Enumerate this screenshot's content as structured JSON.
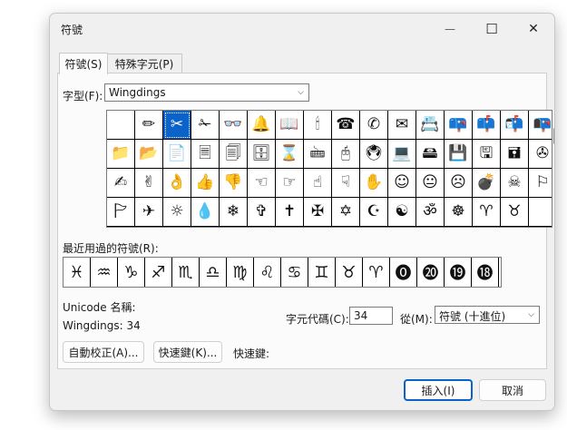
{
  "window": {
    "title": "符號",
    "controls": [
      "—",
      "☐",
      "✕"
    ]
  },
  "tabs": [
    {
      "label": "符號(S)",
      "active": true
    },
    {
      "label": "特殊字元(P)",
      "active": false
    }
  ],
  "font": {
    "label": "字型(F):",
    "value": "Wingdings"
  },
  "symbol_grid": {
    "rows": [
      [
        "",
        "✏",
        "✂",
        "✁",
        "👓",
        "🔔",
        "📖",
        "🕯",
        "☎",
        "✆",
        "✉",
        "📇",
        "📪",
        "📫",
        "📬",
        "📭"
      ],
      [
        "📁",
        "📂",
        "📄",
        "🗏",
        "🗐",
        "🗄",
        "⌛",
        "🖮",
        "🖰",
        "🖲",
        "💻",
        "🖴",
        "💾",
        "🖫",
        "🖬",
        "✇"
      ],
      [
        "✍",
        "✌",
        "👌",
        "👍",
        "👎",
        "☜",
        "☞",
        "☝",
        "☟",
        "✋",
        "☺",
        "😐",
        "☹",
        "💣",
        "☠",
        "⚐"
      ],
      [
        "🏱",
        "✈",
        "☼",
        "💧",
        "❄",
        "✞",
        "✝",
        "✠",
        "✡",
        "☪",
        "☯",
        "ॐ",
        "☸",
        "♈",
        "♉",
        ""
      ]
    ],
    "selected": [
      0,
      2
    ]
  },
  "recent": {
    "label": "最近用過的符號(R):",
    "symbols": [
      "♓",
      "♒",
      "♑",
      "♐",
      "♏",
      "♎",
      "♍",
      "♌",
      "♋",
      "♊",
      "♉",
      "♈",
      "⓿",
      "⓴",
      "⓳",
      "⓲"
    ]
  },
  "unicode_name": {
    "label": "Unicode 名稱:",
    "value": "Wingdings: 34"
  },
  "char_code": {
    "label": "字元代碼(C):",
    "value": "34"
  },
  "from": {
    "label": "從(M):",
    "value": "符號 (十進位)"
  },
  "buttons": {
    "autocorrect": "自動校正(A)...",
    "shortcut_key": "快速鍵(K)...",
    "shortcut_label": "快速鍵:",
    "insert": "插入(I)",
    "cancel": "取消"
  },
  "colors": {
    "accent": "#0b62c9",
    "dialog_bg": "#f0f0f0",
    "panel_bg": "#fbfbfb"
  }
}
